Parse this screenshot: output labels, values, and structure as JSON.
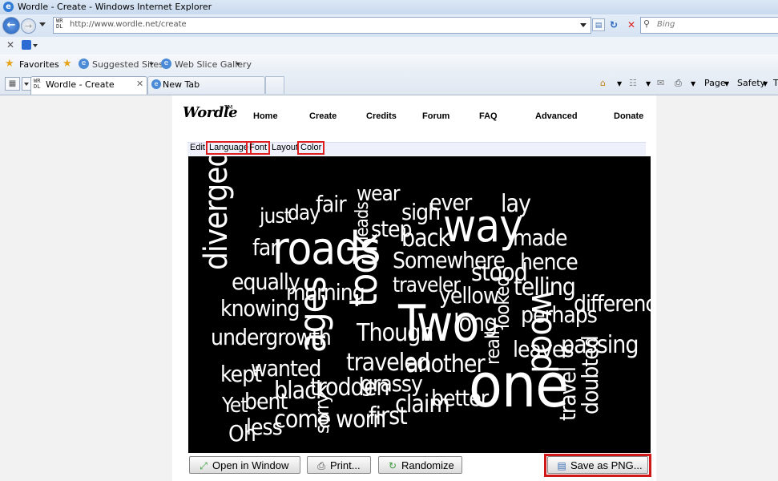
{
  "window": {
    "title": "Wordle - Create - Windows Internet Explorer"
  },
  "address_bar": {
    "url": "http://www.wordle.net/create",
    "favicon_text": "WR\nDL"
  },
  "search": {
    "placeholder": "Bing"
  },
  "favorites_bar": {
    "favorites_label": "Favorites",
    "items": [
      {
        "label": "Suggested Sites"
      },
      {
        "label": "Web Slice Gallery"
      }
    ]
  },
  "tabs": [
    {
      "label": "Wordle - Create",
      "active": true
    },
    {
      "label": "New Tab",
      "active": false
    }
  ],
  "command_bar": {
    "page_label": "Page",
    "safety_label": "Safety",
    "tools_label": "T"
  },
  "site": {
    "logo": "Wordle",
    "logo_tm": "TM",
    "nav": [
      "Home",
      "Create",
      "Credits",
      "Forum",
      "FAQ",
      "Advanced",
      "Donate"
    ],
    "subnav": [
      {
        "label": "Edit",
        "highlighted": false
      },
      {
        "label": "Language",
        "highlighted": true
      },
      {
        "label": "Font",
        "highlighted": true
      },
      {
        "label": "Layout",
        "highlighted": false
      },
      {
        "label": "Color",
        "highlighted": true
      }
    ]
  },
  "cloud": {
    "background": "#000000",
    "word_color": "#ffffff",
    "words": [
      "diverged",
      "roads",
      "ages",
      "Two",
      "one",
      "way",
      "took",
      "wood",
      "just",
      "day",
      "fair",
      "wear",
      "leads",
      "step",
      "sigh",
      "ever",
      "lay",
      "made",
      "far",
      "back",
      "Somewhere",
      "stood",
      "hence",
      "equally",
      "morning",
      "traveler",
      "yellow",
      "telling",
      "knowing",
      "Though",
      "long",
      "looked",
      "perhaps",
      "difference",
      "undergrowth",
      "really",
      "leaves",
      "passing",
      "kept",
      "wanted",
      "traveled",
      "another",
      "Yet",
      "bent",
      "black",
      "trodden",
      "grassy",
      "claim",
      "better",
      "travel",
      "doubted",
      "Oh",
      "less",
      "come",
      "sorry",
      "worn",
      "first"
    ]
  },
  "buttons": {
    "open_window": "Open in Window",
    "print": "Print...",
    "randomize": "Randomize",
    "save_png": "Save as PNG..."
  },
  "colors": {
    "highlight_red": "#e02020",
    "ie_blue": "#2f7bd6"
  }
}
